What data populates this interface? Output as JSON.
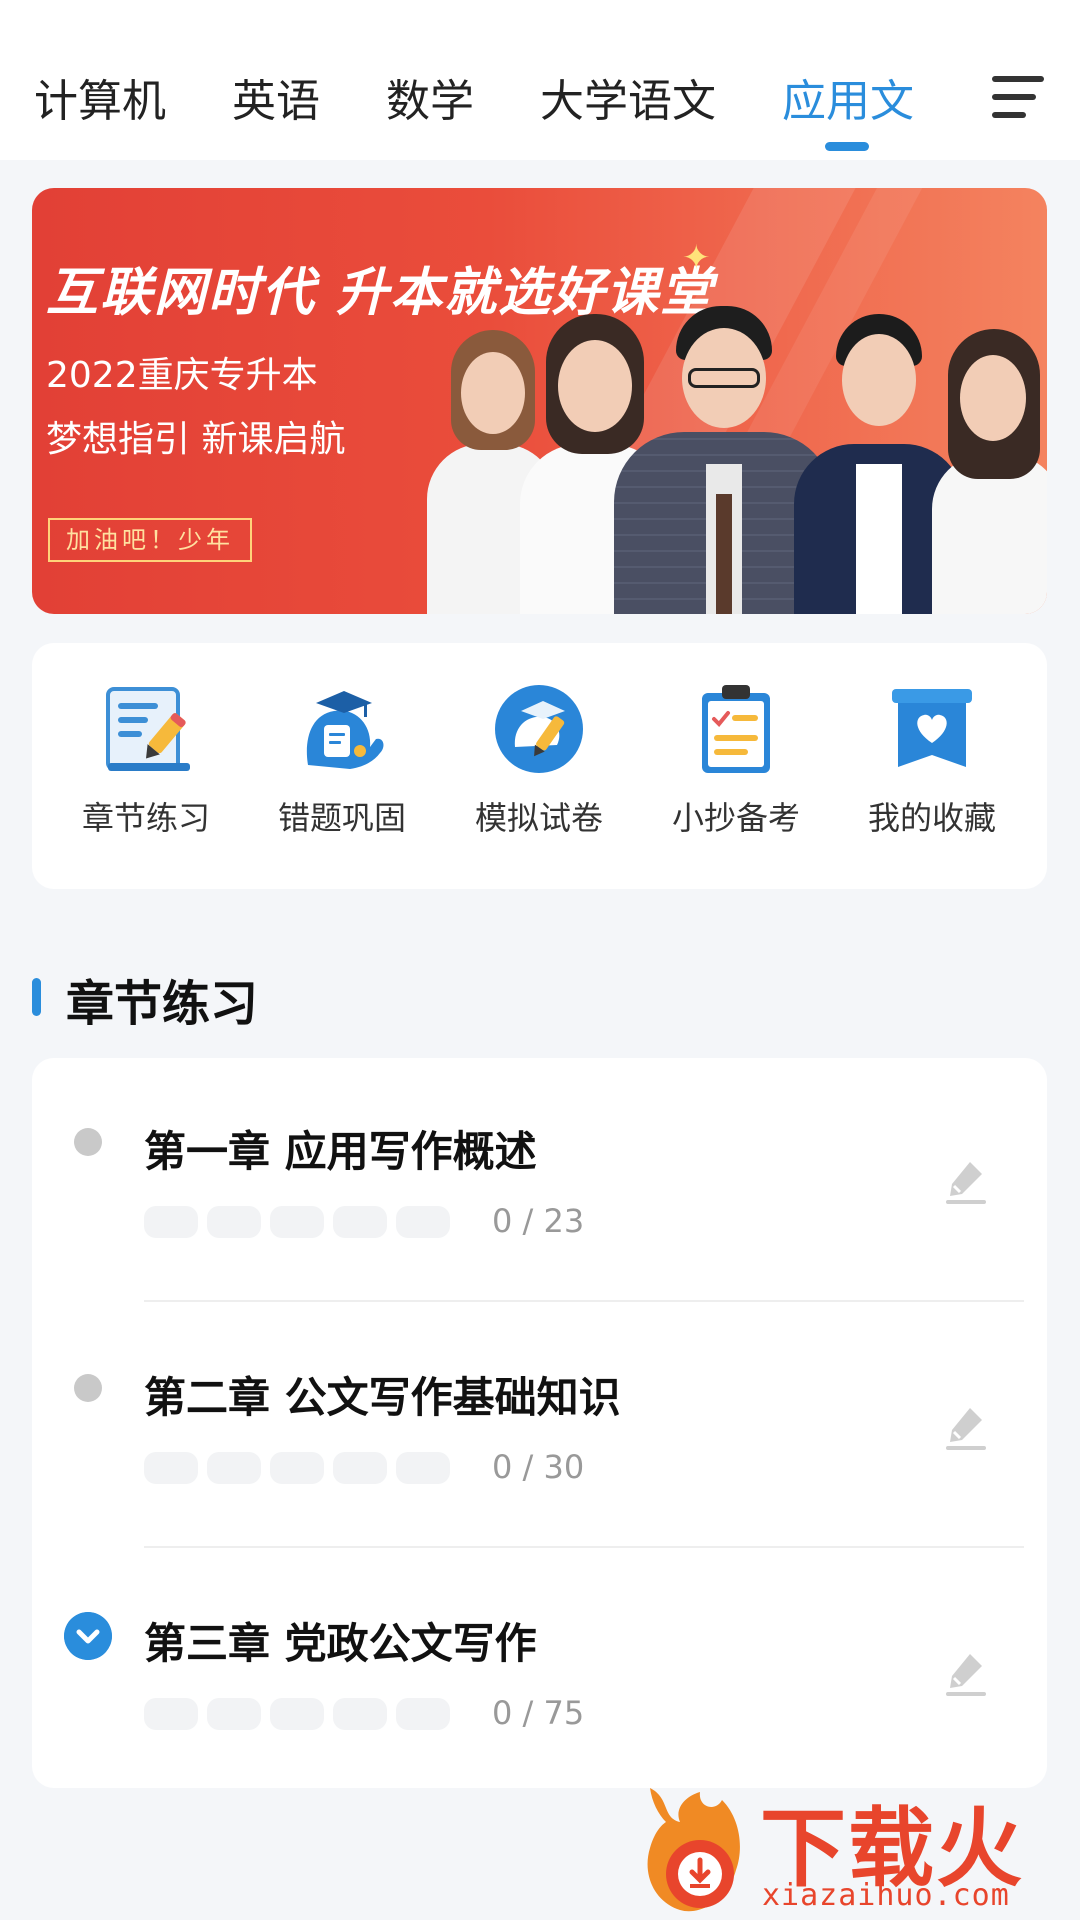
{
  "tabs": [
    {
      "label": "计算机",
      "active": false
    },
    {
      "label": "英语",
      "active": false
    },
    {
      "label": "数学",
      "active": false
    },
    {
      "label": "大学语文",
      "active": false
    },
    {
      "label": "应用文",
      "active": true
    }
  ],
  "menu_icon": "menu-icon",
  "banner": {
    "headline": "互联网时代 升本就选好课堂",
    "line1": "2022重庆专升本",
    "line2": "梦想指引 新课启航",
    "tag": "加油吧！少年"
  },
  "quick_entries": [
    {
      "label": "章节练习",
      "icon": "chapter-practice-icon"
    },
    {
      "label": "错题巩固",
      "icon": "wrong-questions-icon"
    },
    {
      "label": "模拟试卷",
      "icon": "mock-exam-icon"
    },
    {
      "label": "小抄备考",
      "icon": "cheat-sheet-icon"
    },
    {
      "label": "我的收藏",
      "icon": "favorites-icon"
    }
  ],
  "section_title": "章节练习",
  "chapters": [
    {
      "title": "第一章 应用写作概述",
      "progress": "0 / 23",
      "done": 0,
      "total": 23,
      "state": "collapsed"
    },
    {
      "title": "第二章 公文写作基础知识",
      "progress": "0 / 30",
      "done": 0,
      "total": 30,
      "state": "collapsed"
    },
    {
      "title": "第三章 党政公文写作",
      "progress": "0 / 75",
      "done": 0,
      "total": 75,
      "state": "expanded"
    }
  ],
  "colors": {
    "accent": "#2a8ddc",
    "banner": "#e24036",
    "watermark": "#e8452c"
  },
  "watermark": {
    "text": "下载火",
    "url": "xiazaihuo.com"
  }
}
